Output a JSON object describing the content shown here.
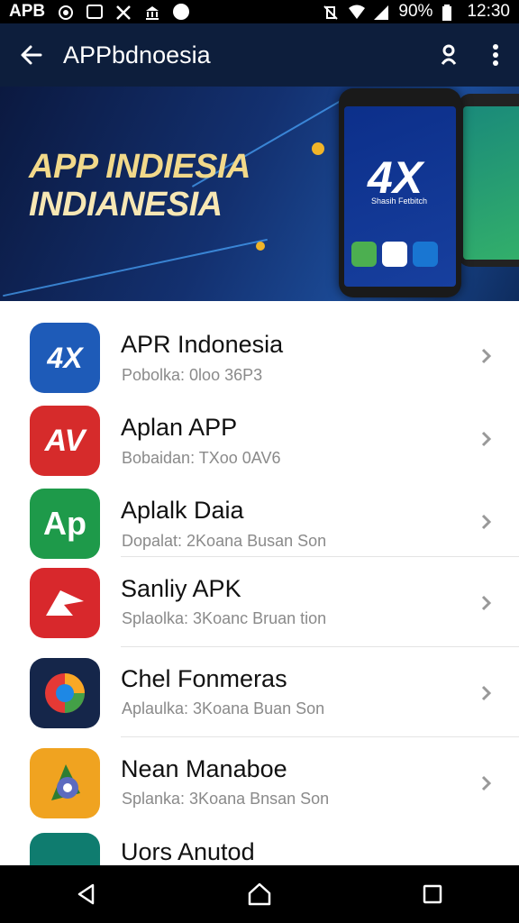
{
  "status_bar": {
    "carrier_text": "APB",
    "battery_percent": "90%",
    "time": "12:30",
    "icons": [
      "whatsapp-icon",
      "gallery-icon",
      "no-signal-icon",
      "bank-icon",
      "circle-app-icon",
      "silent-mode-icon",
      "wifi-icon",
      "signal-icon",
      "battery-icon"
    ]
  },
  "app_bar": {
    "title": "APPbdnoesia",
    "back_icon": "arrow-left-icon",
    "actions": [
      "account-icon",
      "overflow-menu-icon"
    ]
  },
  "banner": {
    "line1": "APP INDIESIA",
    "line2": "INDIANESIA",
    "phone_logo": "4X",
    "phone_tagline": "Shasih Fetbitch"
  },
  "apps": [
    {
      "name": "APR Indonesia",
      "subtitle": "Pobolka: 0loo 36P3",
      "icon": "apr-indonesia-icon",
      "icon_color": "#1e5bb8",
      "icon_text": "4X"
    },
    {
      "name": "Aplan APP",
      "subtitle": "Bobaidan: TXoo 0AV6",
      "icon": "aplan-app-icon",
      "icon_color": "#d62b2b",
      "icon_text": "AV"
    },
    {
      "name": "Aplalk Daia",
      "subtitle": "Dopalat: 2Koana Busan Son",
      "icon": "aplalk-daia-icon",
      "icon_color": "#1e9a4a",
      "icon_text": "Ap"
    },
    {
      "name": "Sanliy APK",
      "subtitle": "Splaolka: 3Koanc Bruan tion",
      "icon": "sanliy-apk-icon",
      "icon_color": "#d8282c",
      "icon_text": ""
    },
    {
      "name": "Chel Fonmeras",
      "subtitle": "Aplaulka: 3Koana Buan Son",
      "icon": "chel-fonmeras-icon",
      "icon_color": "#15264a",
      "icon_text": ""
    },
    {
      "name": "Nean Manaboe",
      "subtitle": "Splanka: 3Koana Bnsan Son",
      "icon": "nean-manaboe-icon",
      "icon_color": "#f0a320",
      "icon_text": ""
    },
    {
      "name": "Uors Anutod",
      "subtitle": "",
      "icon": "uors-anutod-icon",
      "icon_color": "#0f7c6f",
      "icon_text": ""
    }
  ],
  "nav_bar": {
    "buttons": [
      "back-nav-icon",
      "home-nav-icon",
      "recents-nav-icon"
    ]
  }
}
